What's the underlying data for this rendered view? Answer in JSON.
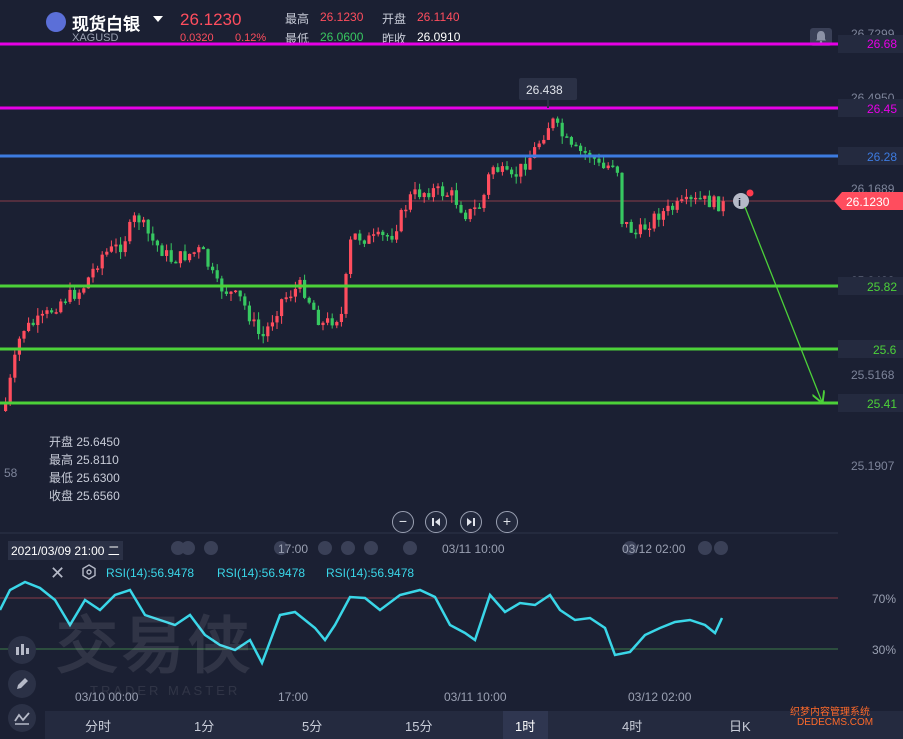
{
  "header": {
    "name": "现货白银",
    "symbol": "XAGUSD",
    "price": "26.1230",
    "change": "0.0320",
    "change_pct": "0.12%",
    "high_label": "最高",
    "high": "26.1230",
    "open_label": "开盘",
    "open": "26.1140",
    "low_label": "最低",
    "low": "26.0600",
    "prev_close_label": "昨收",
    "prev_close": "26.0910"
  },
  "price_axis": {
    "ticks": [
      "26.7299",
      "26.4950",
      "26.1689",
      "25.8428",
      "25.5168",
      "25.1907"
    ]
  },
  "level_lines": [
    {
      "label": "26.68",
      "color": "#e600e6"
    },
    {
      "label": "26.45",
      "color": "#e600e6"
    },
    {
      "label": "26.28",
      "color": "#3d7be0"
    },
    {
      "label": "25.82",
      "color": "#4cd139"
    },
    {
      "label": "25.6",
      "color": "#4cd139"
    },
    {
      "label": "25.41",
      "color": "#4cd139"
    }
  ],
  "current_price_tag": "26.1230",
  "high_callout": "26.438",
  "crosshair_ohlc": {
    "open_label": "开盘",
    "open": "25.6450",
    "high_label": "最高",
    "high": "25.8110",
    "low_label": "最低",
    "low": "25.6300",
    "close_label": "收盘",
    "close": "25.6560"
  },
  "left_edge_label": "58",
  "crosshair_datetime": "2021/03/09 21:00 二",
  "time_labels_top": [
    "17:00",
    "03/11 10:00",
    "03/12 02:00"
  ],
  "time_labels_bottom": [
    "03/10 00:00",
    "17:00",
    "03/11 10:00",
    "03/12 02:00"
  ],
  "rsi": {
    "labels": [
      "RSI(14):56.9478",
      "RSI(14):56.9478",
      "RSI(14):56.9478"
    ],
    "upper": "70%",
    "lower": "30%"
  },
  "watermark": {
    "main": "交易侠",
    "sub": "TRADER MASTER"
  },
  "corner_watermark": [
    "织梦内容管理系统",
    "DEDECMS.COM"
  ],
  "tabs": [
    "分时",
    "1分",
    "5分",
    "15分",
    "1时",
    "4时",
    "日K"
  ],
  "active_tab": "1时",
  "colors": {
    "up": "#ff4d5e",
    "down": "#37c861",
    "rsi": "#3ad6e8",
    "magenta": "#e600e6",
    "blue": "#3d7be0",
    "green": "#4cd139"
  },
  "icons": [
    "chevron-down-icon",
    "bell-icon",
    "info-icon",
    "zoom-out-icon",
    "skip-back-icon",
    "skip-forward-icon",
    "zoom-in-icon",
    "close-icon",
    "settings-hex-icon",
    "candles-icon",
    "pen-icon",
    "indicator-icon"
  ]
}
